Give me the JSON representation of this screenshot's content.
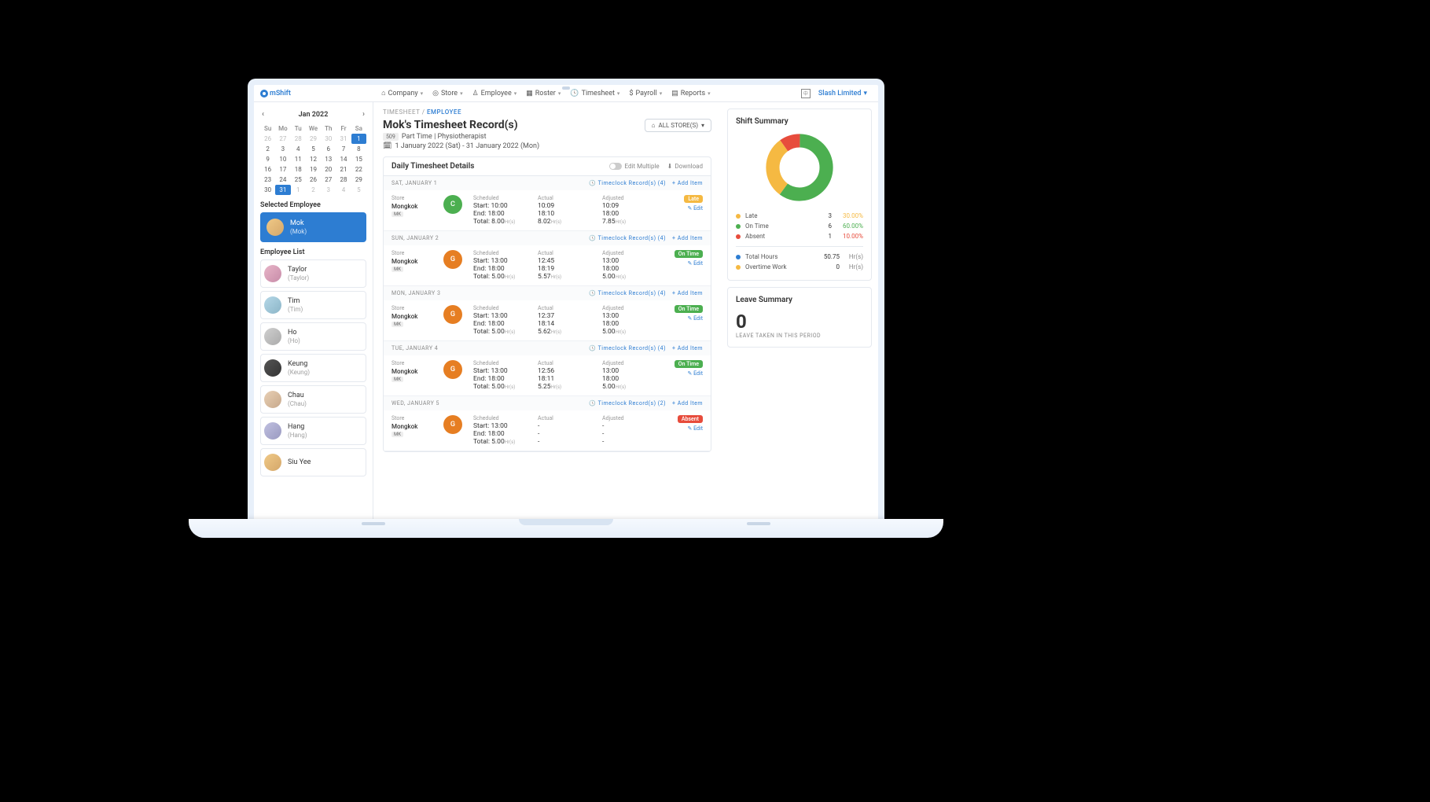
{
  "nav": {
    "logo": "mShift",
    "items": [
      "Company",
      "Store",
      "Employee",
      "Roster",
      "Timesheet",
      "Payroll",
      "Reports"
    ],
    "company": "Slash Limited"
  },
  "calendar": {
    "title": "Jan 2022",
    "weekdays": [
      "Su",
      "Mo",
      "Tu",
      "We",
      "Th",
      "Fr",
      "Sa"
    ],
    "selected_main": 31,
    "selected_alt": 1
  },
  "selected_employee": {
    "label": "Selected Employee",
    "name": "Mok",
    "sub": "(Mok)"
  },
  "employee_list": {
    "label": "Employee List",
    "items": [
      {
        "name": "Taylor",
        "sub": "(Taylor)"
      },
      {
        "name": "Tim",
        "sub": "(Tim)"
      },
      {
        "name": "Ho",
        "sub": "(Ho)"
      },
      {
        "name": "Keung",
        "sub": "(Keung)"
      },
      {
        "name": "Chau",
        "sub": "(Chau)"
      },
      {
        "name": "Hang",
        "sub": "(Hang)"
      },
      {
        "name": "Siu Yee",
        "sub": ""
      }
    ]
  },
  "breadcrumb": {
    "a": "TIMESHEET",
    "b": "EMPLOYEE"
  },
  "page": {
    "title": "Mok's Timesheet Record(s)",
    "emp_id": "509",
    "meta": "Part Time | Physiotherapist",
    "date_range": "1 January 2022 (Sat) - 31 January 2022 (Mon)",
    "store_filter": "ALL STORE(S)"
  },
  "details": {
    "title": "Daily Timesheet Details",
    "edit_multiple": "Edit Multiple",
    "download": "Download",
    "timeclock_link": "Timeclock Record(s)",
    "add_item": "+ Add Item",
    "edit": "Edit",
    "store": "Mongkok",
    "store_tag": "MK",
    "labels": {
      "store": "Store",
      "scheduled": "Scheduled",
      "actual": "Actual",
      "adjusted": "Adjusted"
    },
    "days": [
      {
        "head": "SAT, JANUARY 1",
        "tc_count": "(4)",
        "shift": "C",
        "shift_color": "c",
        "status": "Late",
        "status_class": "late",
        "scheduled": {
          "start": "Start: 10:00",
          "end": "End: 18:00",
          "total": "Total: 8.00",
          "unit": "Hr(s)"
        },
        "actual": {
          "start": "10:09",
          "end": "18:10",
          "total": "8.02",
          "unit": "Hr(s)"
        },
        "adjusted": {
          "start": "10:09",
          "end": "18:00",
          "total": "7.85",
          "unit": "Hr(s)"
        }
      },
      {
        "head": "SUN, JANUARY 2",
        "tc_count": "(4)",
        "shift": "G",
        "shift_color": "g",
        "status": "On Time",
        "status_class": "ontime",
        "scheduled": {
          "start": "Start: 13:00",
          "end": "End: 18:00",
          "total": "Total: 5.00",
          "unit": "Hr(s)"
        },
        "actual": {
          "start": "12:45",
          "end": "18:19",
          "total": "5.57",
          "unit": "Hr(s)"
        },
        "adjusted": {
          "start": "13:00",
          "end": "18:00",
          "total": "5.00",
          "unit": "Hr(s)"
        }
      },
      {
        "head": "MON, JANUARY 3",
        "tc_count": "(4)",
        "shift": "G",
        "shift_color": "g",
        "status": "On Time",
        "status_class": "ontime",
        "scheduled": {
          "start": "Start: 13:00",
          "end": "End: 18:00",
          "total": "Total: 5.00",
          "unit": "Hr(s)"
        },
        "actual": {
          "start": "12:37",
          "end": "18:14",
          "total": "5.62",
          "unit": "Hr(s)"
        },
        "adjusted": {
          "start": "13:00",
          "end": "18:00",
          "total": "5.00",
          "unit": "Hr(s)"
        }
      },
      {
        "head": "TUE, JANUARY 4",
        "tc_count": "(4)",
        "shift": "G",
        "shift_color": "g",
        "status": "On Time",
        "status_class": "ontime",
        "scheduled": {
          "start": "Start: 13:00",
          "end": "End: 18:00",
          "total": "Total: 5.00",
          "unit": "Hr(s)"
        },
        "actual": {
          "start": "12:56",
          "end": "18:11",
          "total": "5.25",
          "unit": "Hr(s)"
        },
        "adjusted": {
          "start": "13:00",
          "end": "18:00",
          "total": "5.00",
          "unit": "Hr(s)"
        }
      },
      {
        "head": "WED, JANUARY 5",
        "tc_count": "(2)",
        "shift": "G",
        "shift_color": "g",
        "status": "Absent",
        "status_class": "absent",
        "scheduled": {
          "start": "Start: 13:00",
          "end": "End: 18:00",
          "total": "Total: 5.00",
          "unit": "Hr(s)"
        },
        "actual": {
          "start": "-",
          "end": "-",
          "total": "-",
          "unit": ""
        },
        "adjusted": {
          "start": "-",
          "end": "-",
          "total": "-",
          "unit": ""
        }
      }
    ]
  },
  "summary": {
    "title": "Shift Summary",
    "rows": [
      {
        "label": "Late",
        "count": "3",
        "pct": "30.00%",
        "color": "#f5b942",
        "pct_color": "#f5b942"
      },
      {
        "label": "On Time",
        "count": "6",
        "pct": "60.00%",
        "color": "#4caf50",
        "pct_color": "#4caf50"
      },
      {
        "label": "Absent",
        "count": "1",
        "pct": "10.00%",
        "color": "#e74c3c",
        "pct_color": "#e74c3c"
      }
    ],
    "totals": [
      {
        "label": "Total Hours",
        "value": "50.75",
        "unit": "Hr(s)",
        "color": "#2d7dd2"
      },
      {
        "label": "Overtime Work",
        "value": "0",
        "unit": "Hr(s)",
        "color": "#f5b942"
      }
    ]
  },
  "leave": {
    "title": "Leave Summary",
    "value": "0",
    "sub": "LEAVE TAKEN IN THIS PERIOD"
  },
  "chart_data": {
    "type": "pie",
    "title": "Shift Summary",
    "series": [
      {
        "name": "Late",
        "value": 3,
        "pct": 30.0,
        "color": "#f5b942"
      },
      {
        "name": "On Time",
        "value": 6,
        "pct": 60.0,
        "color": "#4caf50"
      },
      {
        "name": "Absent",
        "value": 1,
        "pct": 10.0,
        "color": "#e74c3c"
      }
    ]
  }
}
